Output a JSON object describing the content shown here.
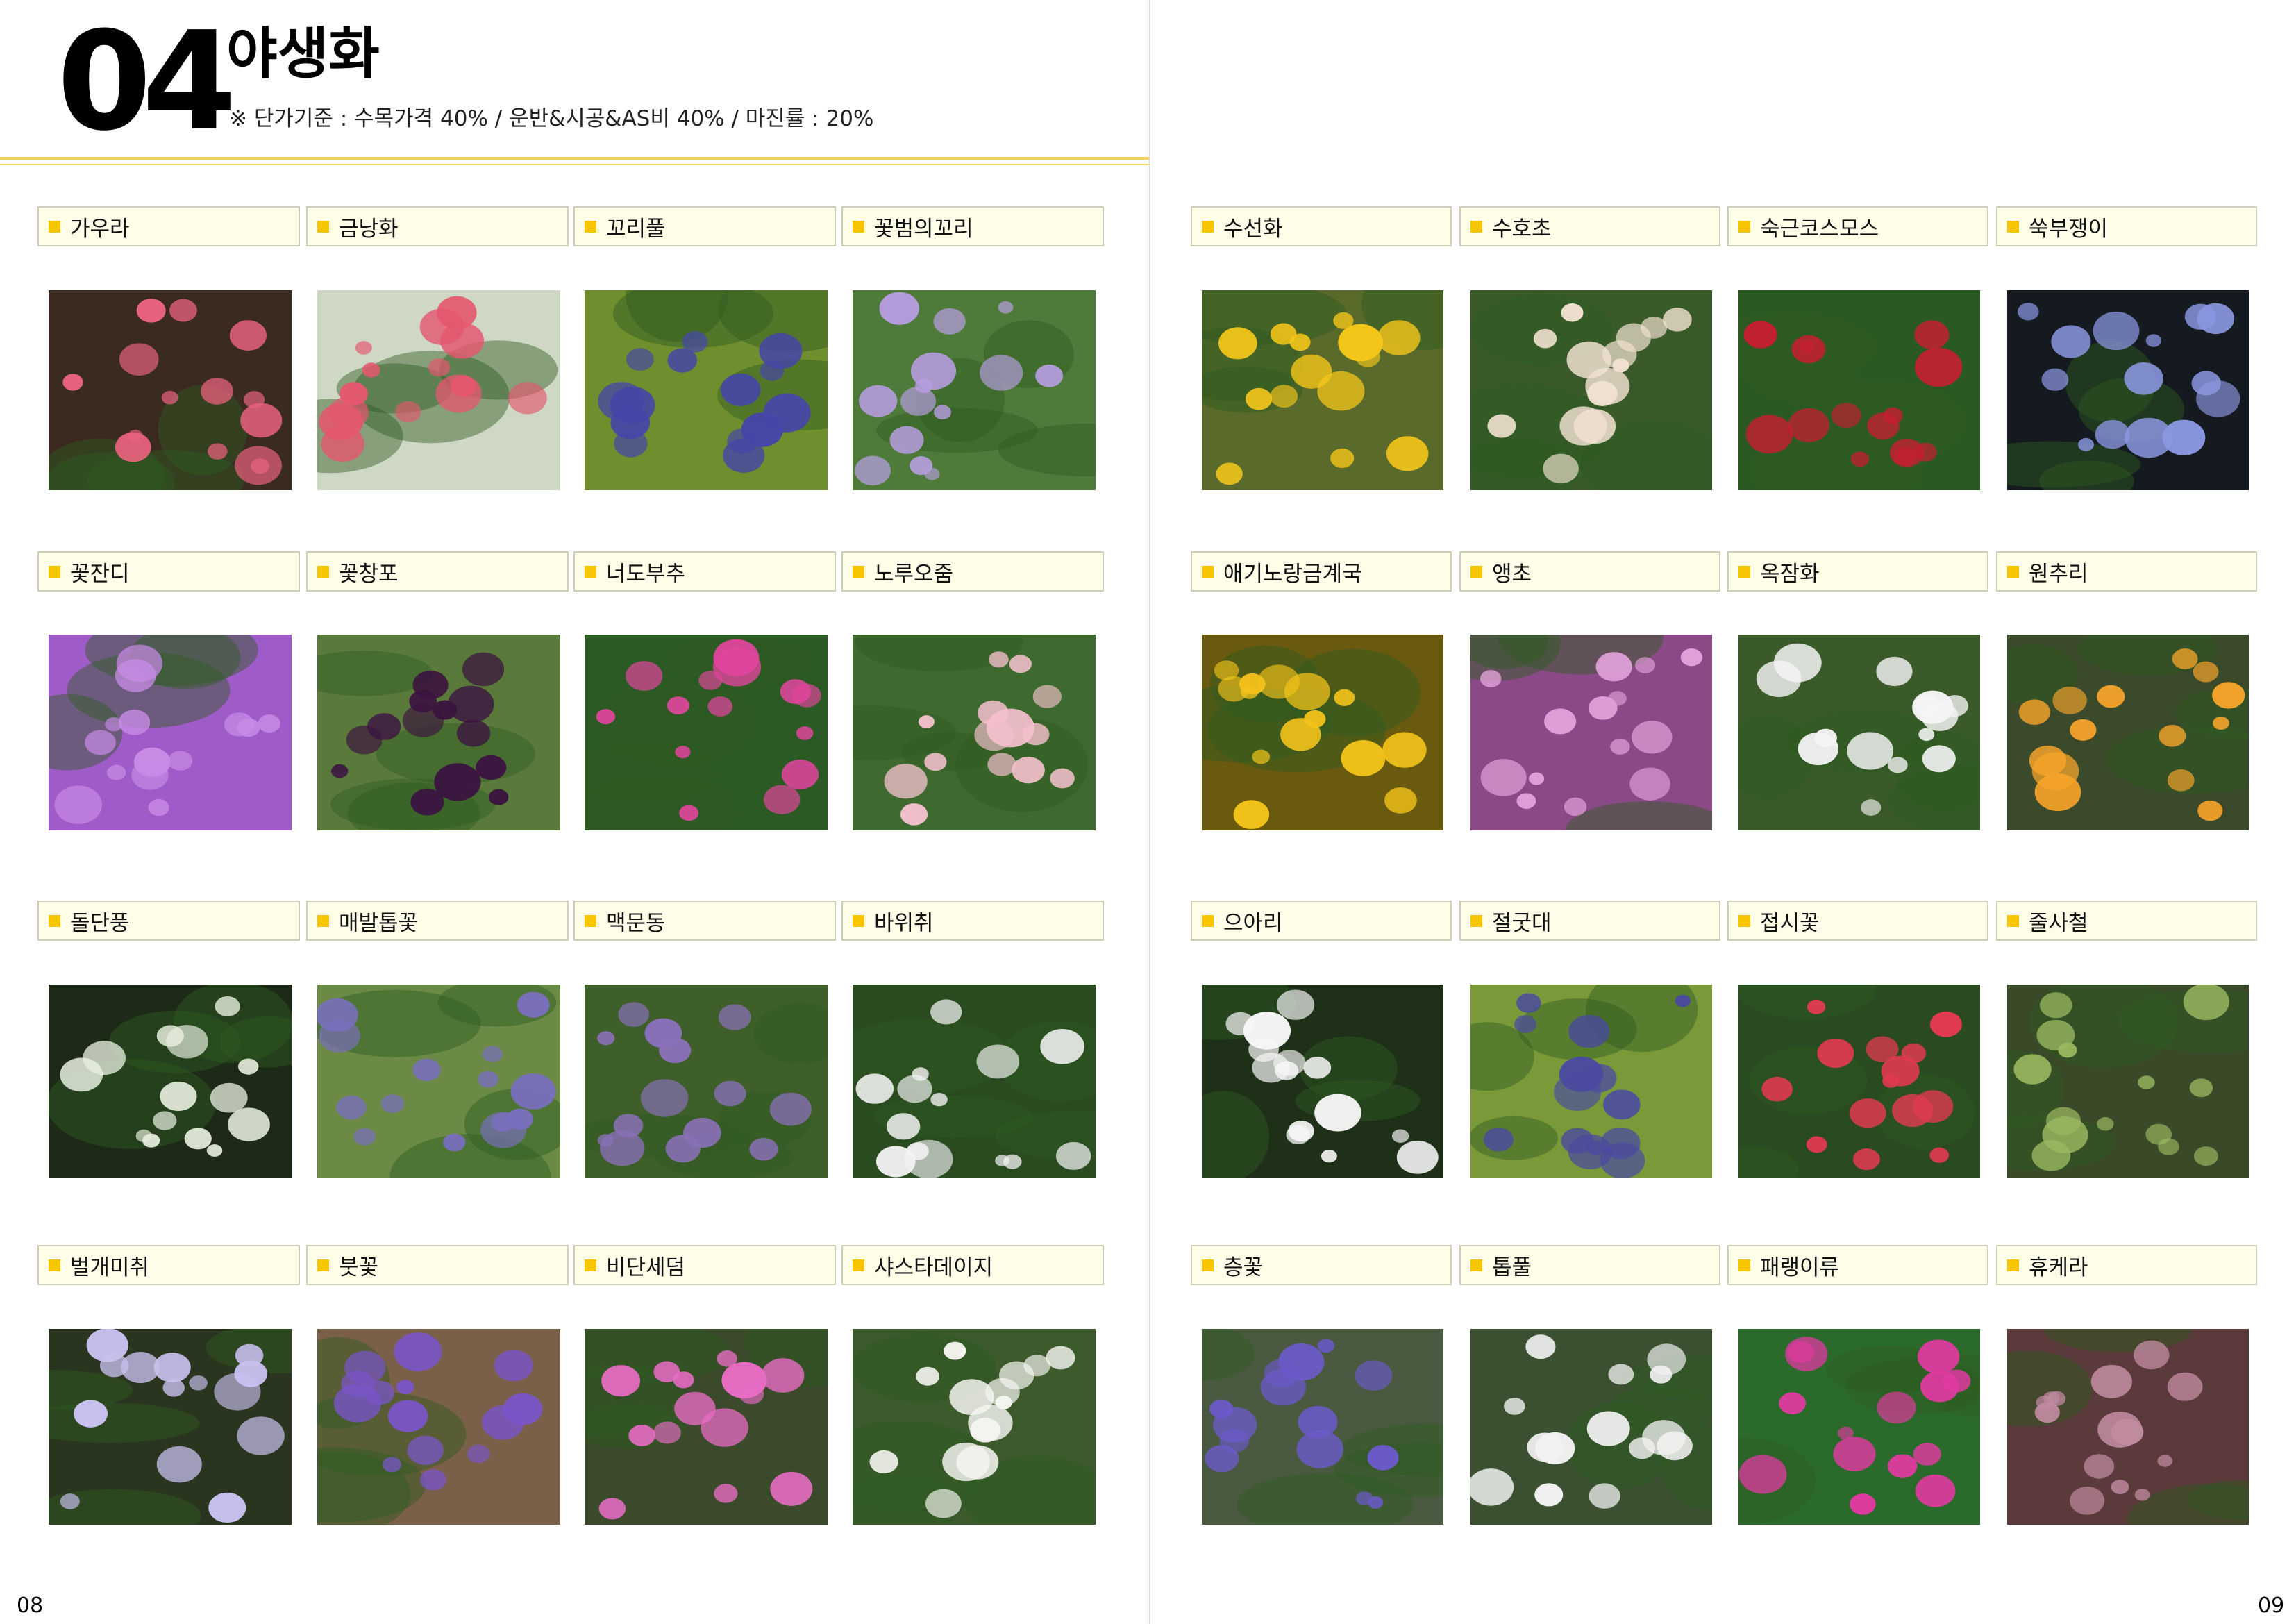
{
  "chapter": {
    "number": "04",
    "title": "야생화",
    "note": "※ 단가기준 : 수목가격 40% / 운반&시공&AS비 40% / 마진률 : 20%"
  },
  "pages": {
    "left_number": "08",
    "right_number": "09"
  },
  "plants": {
    "left": [
      [
        "가우라",
        "금낭화",
        "꼬리풀",
        "꽃범의꼬리"
      ],
      [
        "꽃잔디",
        "꽃창포",
        "너도부추",
        "노루오줌"
      ],
      [
        "돌단풍",
        "매발톱꽃",
        "맥문동",
        "바위취"
      ],
      [
        "벌개미취",
        "붓꽃",
        "비단세덤",
        "샤스타데이지"
      ]
    ],
    "right": [
      [
        "수선화",
        "수호초",
        "숙근코스모스",
        "쑥부쟁이"
      ],
      [
        "애기노랑금계국",
        "앵초",
        "옥잠화",
        "원추리"
      ],
      [
        "으아리",
        "절굿대",
        "접시꽃",
        "줄사철"
      ],
      [
        "층꽃",
        "톱풀",
        "패랭이류",
        "휴케라"
      ]
    ]
  },
  "photo_colors": {
    "left": [
      [
        [
          "#3a2a20",
          "#e8627e"
        ],
        [
          "#cfd8c4",
          "#e4576f"
        ],
        [
          "#6f8f2e",
          "#4646a8"
        ],
        [
          "#4f7b3a",
          "#b79de0"
        ]
      ],
      [
        [
          "#9f5cc8",
          "#c88be6"
        ],
        [
          "#5a7a3c",
          "#3b1440"
        ],
        [
          "#2c5a24",
          "#e0459c"
        ],
        [
          "#3e6a30",
          "#f4c0cc"
        ]
      ],
      [
        [
          "#1e2a18",
          "#e8efe0"
        ],
        [
          "#6b8a46",
          "#7a6fc0"
        ],
        [
          "#3e5e2a",
          "#8a70b8"
        ],
        [
          "#2a4a20",
          "#f2f2f2"
        ]
      ],
      [
        [
          "#2a3520",
          "#c8c0ee"
        ],
        [
          "#7a6048",
          "#7a55c8"
        ],
        [
          "#3a4a2a",
          "#e86cc4"
        ],
        [
          "#3d5a2c",
          "#f4f4f0"
        ]
      ]
    ],
    "right": [
      [
        [
          "#5a6a2a",
          "#f5c71a"
        ],
        [
          "#3a5a2a",
          "#f0e0d0"
        ],
        [
          "#2a5a22",
          "#c81e32"
        ],
        [
          "#141a20",
          "#8a96e0"
        ]
      ],
      [
        [
          "#6a5a10",
          "#f2c21a"
        ],
        [
          "#8a4a88",
          "#e0a0d8"
        ],
        [
          "#3a5a2a",
          "#f4f4f4"
        ],
        [
          "#3a4a2a",
          "#f7a42a"
        ]
      ],
      [
        [
          "#1e3018",
          "#f6f6f6"
        ],
        [
          "#7a9a3a",
          "#4a4aa0"
        ],
        [
          "#2a4a22",
          "#e03a50"
        ],
        [
          "#3a4a28",
          "#9ab860"
        ]
      ],
      [
        [
          "#4a5a40",
          "#6a5ac8"
        ],
        [
          "#3a5030",
          "#f2f2f2"
        ],
        [
          "#2a6a2a",
          "#e03aa0"
        ],
        [
          "#5a3a3a",
          "#c08aa0"
        ]
      ]
    ]
  }
}
